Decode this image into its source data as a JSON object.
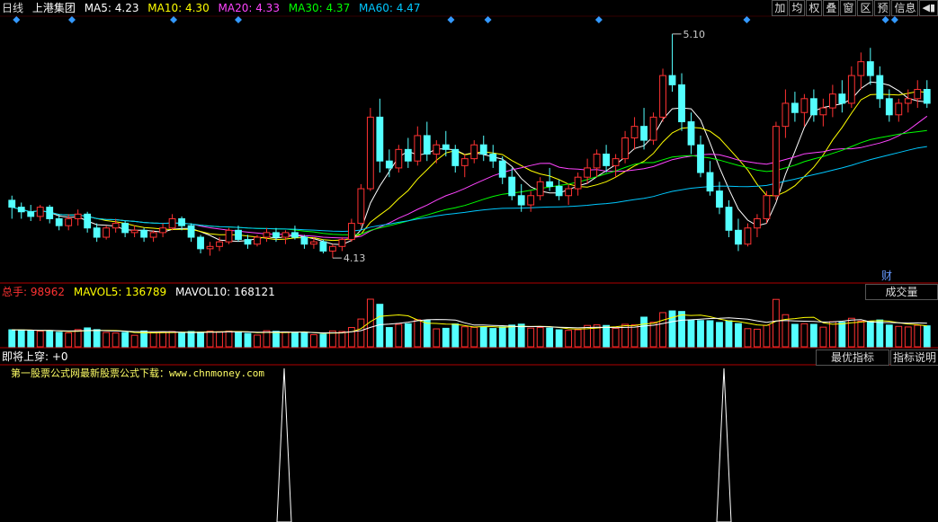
{
  "header": {
    "period": "日线",
    "stock_name": "上港集团",
    "ma": [
      {
        "label": "MA5: 4.23",
        "color": "#ffffff"
      },
      {
        "label": "MA10: 4.30",
        "color": "#ffff00"
      },
      {
        "label": "MA20: 4.33",
        "color": "#ff44ff"
      },
      {
        "label": "MA30: 4.37",
        "color": "#00ff00"
      },
      {
        "label": "MA60: 4.47",
        "color": "#00c8ff"
      }
    ]
  },
  "toolbar": {
    "buttons": [
      "加",
      "均",
      "权",
      "叠",
      "窗",
      "区",
      "预",
      "信息"
    ],
    "exit_icon": "exit-icon"
  },
  "price_panel": {
    "high_label": "5.10",
    "low_label": "4.13",
    "finance_marker": "财"
  },
  "volume_panel": {
    "total_label": "总手: 98962",
    "mavol5_label": "MAVOL5: 136789",
    "mavol10_label": "MAVOL10: 168121",
    "button": "成交量"
  },
  "indicator_panel": {
    "title": "即将上穿: +0",
    "watermark": "第一股票公式网最新股票公式下载：www.chnmoney.com",
    "buttons": [
      "最优指标",
      "指标说明"
    ]
  },
  "colors": {
    "up": "#ff3232",
    "down": "#54ffff",
    "border": "#b00000",
    "marker": "#3399ff"
  },
  "chart_data": {
    "type": "candlestick",
    "candles_approx": [
      [
        4.38,
        4.4,
        4.3,
        4.35
      ],
      [
        4.35,
        4.37,
        4.3,
        4.33
      ],
      [
        4.33,
        4.36,
        4.29,
        4.31
      ],
      [
        4.31,
        4.36,
        4.29,
        4.35
      ],
      [
        4.35,
        4.36,
        4.28,
        4.3
      ],
      [
        4.3,
        4.32,
        4.25,
        4.27
      ],
      [
        4.27,
        4.32,
        4.25,
        4.3
      ],
      [
        4.3,
        4.34,
        4.27,
        4.32
      ],
      [
        4.32,
        4.33,
        4.24,
        4.26
      ],
      [
        4.26,
        4.28,
        4.2,
        4.22
      ],
      [
        4.22,
        4.27,
        4.21,
        4.26
      ],
      [
        4.26,
        4.3,
        4.24,
        4.28
      ],
      [
        4.28,
        4.29,
        4.22,
        4.24
      ],
      [
        4.24,
        4.27,
        4.22,
        4.25
      ],
      [
        4.25,
        4.26,
        4.2,
        4.22
      ],
      [
        4.22,
        4.25,
        4.2,
        4.24
      ],
      [
        4.24,
        4.28,
        4.22,
        4.26
      ],
      [
        4.26,
        4.32,
        4.25,
        4.3
      ],
      [
        4.3,
        4.31,
        4.25,
        4.27
      ],
      [
        4.27,
        4.28,
        4.2,
        4.22
      ],
      [
        4.22,
        4.23,
        4.15,
        4.17
      ],
      [
        4.17,
        4.2,
        4.14,
        4.18
      ],
      [
        4.18,
        4.22,
        4.16,
        4.2
      ],
      [
        4.2,
        4.26,
        4.19,
        4.25
      ],
      [
        4.25,
        4.27,
        4.2,
        4.21
      ],
      [
        4.21,
        4.23,
        4.17,
        4.19
      ],
      [
        4.19,
        4.23,
        4.18,
        4.22
      ],
      [
        4.22,
        4.26,
        4.2,
        4.24
      ],
      [
        4.24,
        4.26,
        4.2,
        4.22
      ],
      [
        4.22,
        4.25,
        4.19,
        4.24
      ],
      [
        4.24,
        4.27,
        4.21,
        4.22
      ],
      [
        4.22,
        4.23,
        4.17,
        4.19
      ],
      [
        4.19,
        4.22,
        4.17,
        4.2
      ],
      [
        4.2,
        4.21,
        4.15,
        4.16
      ],
      [
        4.16,
        4.19,
        4.13,
        4.18
      ],
      [
        4.18,
        4.22,
        4.16,
        4.21
      ],
      [
        4.21,
        4.3,
        4.2,
        4.28
      ],
      [
        4.28,
        4.45,
        4.27,
        4.43
      ],
      [
        4.43,
        4.78,
        4.42,
        4.74
      ],
      [
        4.74,
        4.82,
        4.5,
        4.55
      ],
      [
        4.55,
        4.6,
        4.48,
        4.52
      ],
      [
        4.52,
        4.62,
        4.5,
        4.6
      ],
      [
        4.6,
        4.65,
        4.52,
        4.55
      ],
      [
        4.55,
        4.7,
        4.53,
        4.66
      ],
      [
        4.66,
        4.72,
        4.55,
        4.58
      ],
      [
        4.58,
        4.64,
        4.54,
        4.62
      ],
      [
        4.62,
        4.68,
        4.57,
        4.6
      ],
      [
        4.6,
        4.62,
        4.5,
        4.53
      ],
      [
        4.53,
        4.58,
        4.48,
        4.56
      ],
      [
        4.56,
        4.64,
        4.54,
        4.62
      ],
      [
        4.62,
        4.66,
        4.55,
        4.58
      ],
      [
        4.58,
        4.62,
        4.52,
        4.55
      ],
      [
        4.55,
        4.57,
        4.45,
        4.48
      ],
      [
        4.48,
        4.52,
        4.38,
        4.4
      ],
      [
        4.4,
        4.45,
        4.33,
        4.36
      ],
      [
        4.36,
        4.42,
        4.33,
        4.4
      ],
      [
        4.4,
        4.48,
        4.38,
        4.46
      ],
      [
        4.46,
        4.52,
        4.42,
        4.44
      ],
      [
        4.44,
        4.47,
        4.38,
        4.4
      ],
      [
        4.4,
        4.45,
        4.36,
        4.43
      ],
      [
        4.43,
        4.5,
        4.4,
        4.48
      ],
      [
        4.48,
        4.56,
        4.45,
        4.52
      ],
      [
        4.52,
        4.6,
        4.48,
        4.58
      ],
      [
        4.58,
        4.62,
        4.5,
        4.53
      ],
      [
        4.53,
        4.58,
        4.48,
        4.56
      ],
      [
        4.56,
        4.68,
        4.54,
        4.65
      ],
      [
        4.65,
        4.74,
        4.6,
        4.7
      ],
      [
        4.7,
        4.78,
        4.6,
        4.64
      ],
      [
        4.64,
        4.76,
        4.62,
        4.74
      ],
      [
        4.74,
        4.95,
        4.72,
        4.92
      ],
      [
        4.92,
        5.1,
        4.85,
        4.88
      ],
      [
        4.88,
        4.93,
        4.68,
        4.72
      ],
      [
        4.72,
        4.76,
        4.58,
        4.62
      ],
      [
        4.62,
        4.66,
        4.48,
        4.5
      ],
      [
        4.5,
        4.55,
        4.4,
        4.42
      ],
      [
        4.42,
        4.46,
        4.32,
        4.35
      ],
      [
        4.35,
        4.38,
        4.22,
        4.25
      ],
      [
        4.25,
        4.3,
        4.16,
        4.19
      ],
      [
        4.19,
        4.28,
        4.18,
        4.26
      ],
      [
        4.26,
        4.32,
        4.22,
        4.3
      ],
      [
        4.3,
        4.42,
        4.28,
        4.4
      ],
      [
        4.4,
        4.72,
        4.38,
        4.7
      ],
      [
        4.7,
        4.86,
        4.65,
        4.8
      ],
      [
        4.8,
        4.85,
        4.72,
        4.76
      ],
      [
        4.76,
        4.84,
        4.7,
        4.82
      ],
      [
        4.82,
        4.86,
        4.72,
        4.75
      ],
      [
        4.75,
        4.82,
        4.7,
        4.78
      ],
      [
        4.78,
        4.88,
        4.74,
        4.84
      ],
      [
        4.84,
        4.9,
        4.76,
        4.8
      ],
      [
        4.8,
        4.96,
        4.78,
        4.92
      ],
      [
        4.92,
        5.02,
        4.86,
        4.98
      ],
      [
        4.98,
        5.04,
        4.88,
        4.92
      ],
      [
        4.92,
        4.96,
        4.78,
        4.82
      ],
      [
        4.82,
        4.86,
        4.72,
        4.75
      ],
      [
        4.75,
        4.82,
        4.72,
        4.8
      ],
      [
        4.8,
        4.86,
        4.76,
        4.82
      ],
      [
        4.82,
        4.9,
        4.78,
        4.86
      ],
      [
        4.86,
        4.9,
        4.78,
        4.8
      ]
    ],
    "volume_axis_note": "volume panel shows MAVOL5 and MAVOL10 lines",
    "xlabel": "",
    "ylabel": ""
  }
}
